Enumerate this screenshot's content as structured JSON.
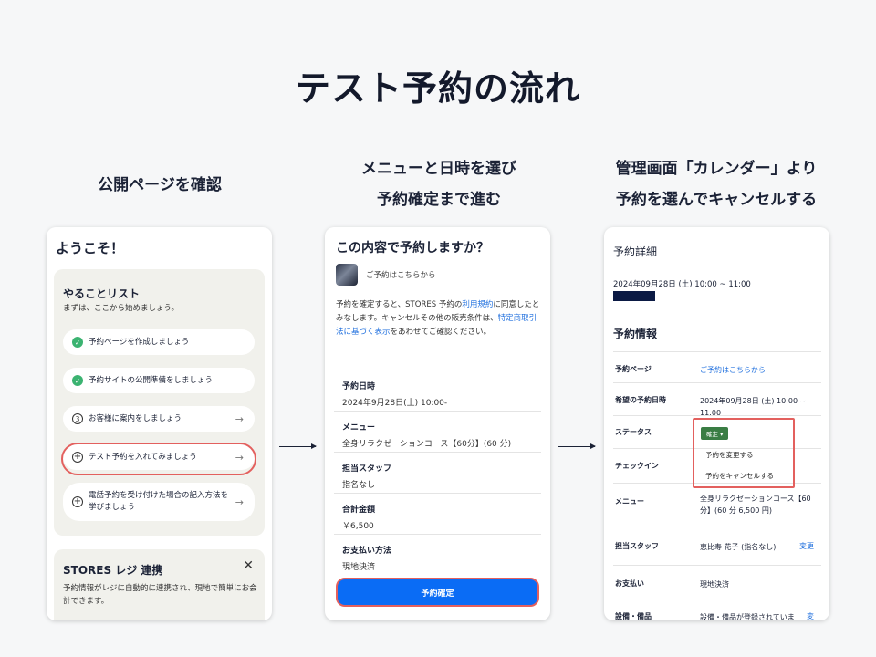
{
  "title": "テスト予約の流れ",
  "captions": {
    "step1": "公開ページを確認",
    "step2_line1": "メニューと日時を選び",
    "step2_line2": "予約確定まで進む",
    "step3_line1": "管理画面「カレンダー」より",
    "step3_line2": "予約を選んでキャンセルする"
  },
  "card1": {
    "welcome": "ようこそ！",
    "todo_title": "やることリスト",
    "todo_sub": "まずは、ここから始めましょう。",
    "tasks": [
      {
        "label": "予約ページを作成しましょう",
        "icon": "check-icon"
      },
      {
        "label": "予約サイトの公開準備をしましょう",
        "icon": "check-icon"
      },
      {
        "label": "お客様に案内をしましょう",
        "icon": "number-3-icon",
        "num": "3"
      },
      {
        "label": "テスト予約を入れてみましょう",
        "icon": "plus-circle-icon"
      },
      {
        "label": "電話予約を受け付けた場合の記入方法を学びましょう",
        "icon": "plus-circle-icon"
      }
    ],
    "stores_title": "STORES レジ 連携",
    "stores_desc": "予約情報がレジに自動的に連携され、現地で簡単にお会計できます。"
  },
  "card2": {
    "title": "この内容で予約しますか？",
    "reserve_label": "ご予約はこちらから",
    "terms_pre": "予約を確定すると、STORES 予約の",
    "terms_link1": "利用規約",
    "terms_mid": "に同意したとみなします。キャンセルその他の販売条件は、",
    "terms_link2": "特定商取引法に基づく表示",
    "terms_post": "をあわせてご確認ください。",
    "rows": [
      {
        "label": "予約日時",
        "value": "2024年9月28日(土) 10:00-"
      },
      {
        "label": "メニュー",
        "value": "全身リラクゼーションコース【60分】(60 分)"
      },
      {
        "label": "担当スタッフ",
        "value": "指名なし"
      },
      {
        "label": "合計金額",
        "value": "￥6,500"
      },
      {
        "label": "お支払い方法",
        "value": "現地決済"
      }
    ],
    "confirm_button": "予約確定"
  },
  "card3": {
    "title": "予約詳細",
    "date": "2024年09月28日 (土) 10:00 ~ 11:00",
    "section": "予約情報",
    "rows": [
      {
        "k": "予約ページ",
        "v": "ご予約はこちらから"
      },
      {
        "k": "希望の予約日時",
        "v": "2024年09月28日 (土) 10:00 ~ 11:00"
      },
      {
        "k": "ステータス",
        "v": ""
      },
      {
        "k": "チェックイン",
        "v": ""
      },
      {
        "k": "メニュー",
        "v": "全身リラクゼーションコース【60分】(60 分 6,500 円)"
      },
      {
        "k": "担当スタッフ",
        "v": "恵比寿 花子 (指名なし)",
        "change": "変更"
      },
      {
        "k": "お支払い",
        "v": "現地決済"
      },
      {
        "k": "設備・備品",
        "v": "設備・備品が登録されていま",
        "change": "変"
      }
    ],
    "status_badge": "確定",
    "dropdown": [
      "予約を変更する",
      "予約をキャンセルする"
    ]
  },
  "colors": {
    "highlight": "#e3605e",
    "primary": "#0a6cf5",
    "check": "#3bb371",
    "link": "#1f6fde"
  }
}
